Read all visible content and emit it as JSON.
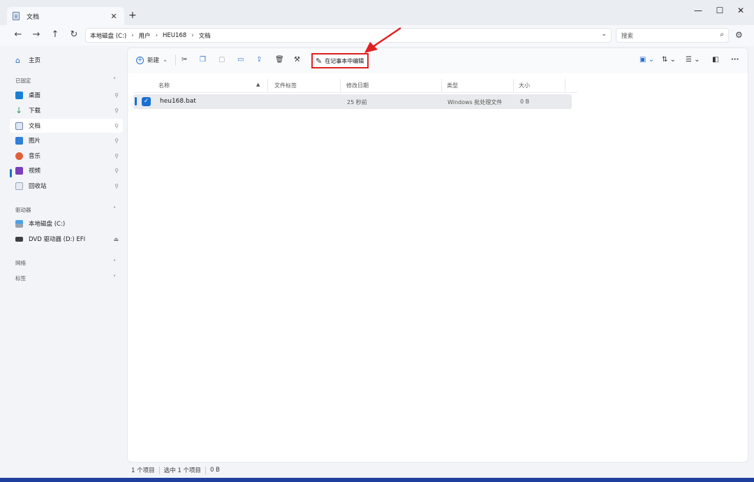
{
  "window": {
    "tab_title": "文档",
    "tab_close": "✕",
    "new_tab": "+",
    "minimize": "—",
    "maximize": "☐",
    "close": "✕"
  },
  "address": {
    "back": "←",
    "forward": "→",
    "up": "↑",
    "refresh": "↻",
    "breadcrumb": [
      "本地磁盘 (C:)",
      "用户",
      "HEU168",
      "文档"
    ],
    "search_placeholder": "搜索"
  },
  "sidebar": {
    "home": "主页",
    "pinned_header": "已固定",
    "pinned": [
      {
        "label": "桌面",
        "icon": "desktop-icon",
        "color": "#1a7fd4"
      },
      {
        "label": "下载",
        "icon": "download-icon",
        "color": "#2a9d5c"
      },
      {
        "label": "文档",
        "icon": "document-icon",
        "color": "#6c86b0"
      },
      {
        "label": "图片",
        "icon": "pictures-icon",
        "color": "#2f7ed8"
      },
      {
        "label": "音乐",
        "icon": "music-icon",
        "color": "#e0603a"
      },
      {
        "label": "视频",
        "icon": "videos-icon",
        "color": "#7b3fbf"
      },
      {
        "label": "回收站",
        "icon": "recycle-bin-icon",
        "color": "#9aa7b8"
      }
    ],
    "drives_header": "驱动器",
    "drives": [
      {
        "label": "本地磁盘 (C:)",
        "icon": "local-disk-icon"
      },
      {
        "label": "DVD 驱动器 (D:) EFI",
        "icon": "dvd-drive-icon"
      }
    ],
    "network_header": "网络",
    "tags_header": "标签"
  },
  "toolbar": {
    "new_label": "新建",
    "edit_in_notepad": "在记事本中编辑"
  },
  "table": {
    "columns": [
      "名称",
      "文件标签",
      "修改日期",
      "类型",
      "大小"
    ],
    "rows": [
      {
        "name": "heu168.bat",
        "tag": "",
        "modified": "25 秒前",
        "type": "Windows 批处理文件",
        "size": "0 B"
      }
    ]
  },
  "status": {
    "count": "1 个项目",
    "selected": "选中 1 个项目",
    "size": "0 B"
  },
  "colors": {
    "accent": "#1a6fd1",
    "highlight_box": "#e02020"
  }
}
